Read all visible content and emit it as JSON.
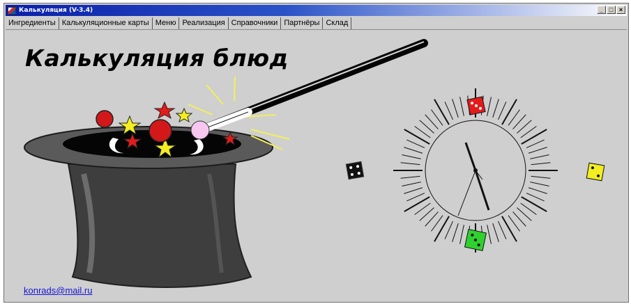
{
  "window": {
    "title": "Калькуляция (V-3.4)",
    "controls": {
      "minimize": "_",
      "maximize": "□",
      "close": "×"
    }
  },
  "menu": {
    "items": [
      "Ингредиенты",
      "Калькуляционные карты",
      "Меню",
      "Реализация",
      "Справочники",
      "Партнёры",
      "Склад"
    ]
  },
  "main": {
    "heading": "Калькуляция блюд",
    "email": "konrads@mail.ru"
  },
  "colors": {
    "titlebar_start": "#0a1fa8",
    "background": "#cfcfcf",
    "link": "#1515d8",
    "die_red": "#e31b1b",
    "die_yellow": "#f2ee22",
    "die_green": "#2fd12f",
    "die_black": "#111111"
  },
  "icons": [
    "app-icon",
    "minimize-icon",
    "maximize-icon",
    "close-icon"
  ]
}
